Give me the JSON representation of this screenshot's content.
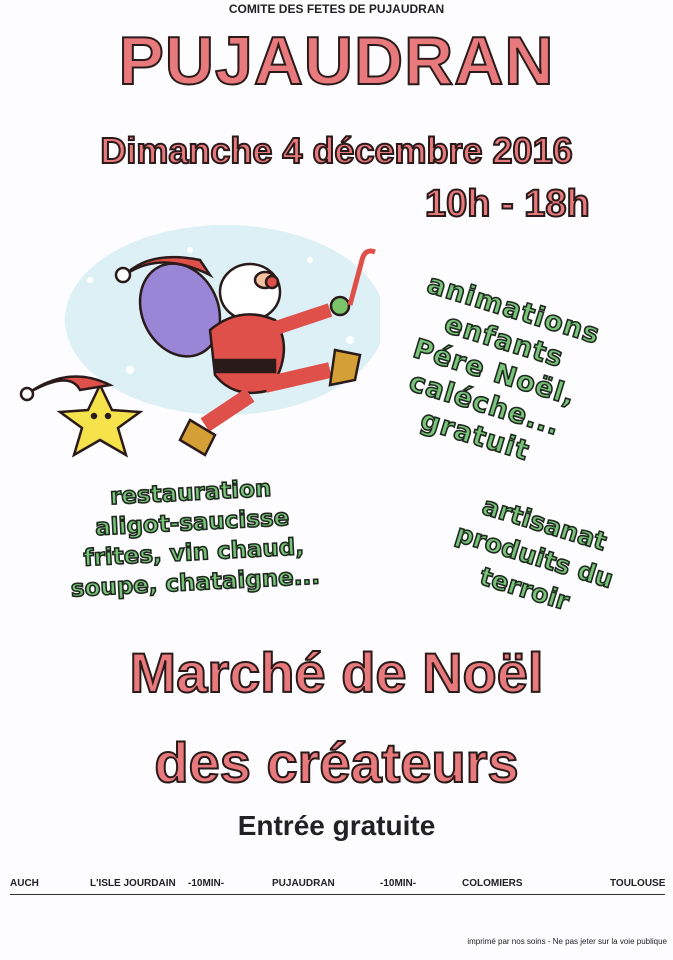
{
  "header": {
    "organizer": "COMITE DES FETES DE PUJAUDRAN",
    "town": "PUJAUDRAN",
    "date": "Dimanche 4 décembre 2016",
    "hours": "10h - 18h"
  },
  "animations": [
    "animations",
    "enfants",
    "Pére Noël,",
    "caléche...",
    "gratuit"
  ],
  "restauration": [
    "restauration",
    "aligot-saucisse",
    "frites, vin chaud,",
    "soupe, chataigne..."
  ],
  "artisanat": [
    "artisanat",
    "produits du",
    "terroir"
  ],
  "title": {
    "line1": "Marché de Noël",
    "line2": "des créateurs",
    "entry": "Entrée gratuite"
  },
  "route": [
    "AUCH",
    "L'ISLE JOURDAIN",
    "-10MIN-",
    "PUJAUDRAN",
    "-10MIN-",
    "COLOMIERS",
    "TOULOUSE"
  ],
  "footer": "imprimé par nos soins - Ne pas jeter sur la voie publique",
  "illustration": {
    "santa": "santa-claus-icon",
    "star": "star-with-hat-icon",
    "colors": {
      "red_text": "#e8797c",
      "green_text": "#79c47a",
      "santa_red": "#e0504a",
      "sack": "#9a86d6",
      "snow_bg": "#dcf0f6",
      "star": "#f6e24a"
    }
  }
}
